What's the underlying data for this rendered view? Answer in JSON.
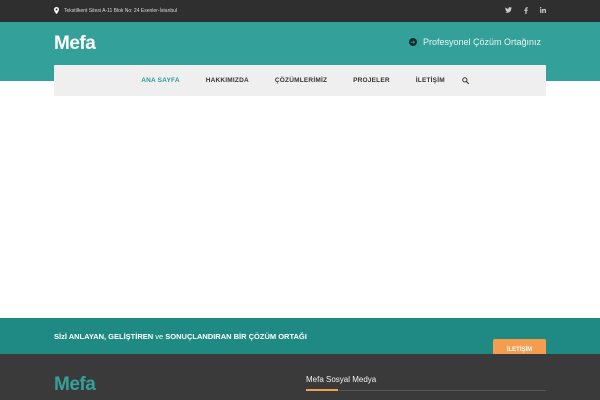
{
  "topbar": {
    "address": "Tekstilkent Sitesi A-11 Blok No: 24 Esenler-İstanbul",
    "icons": [
      "map-pin-icon",
      "twitter-icon",
      "facebook-icon",
      "linkedin-icon"
    ]
  },
  "header": {
    "logo": "Mefa",
    "tagline": "Profesyonel Çözüm Ortağınız"
  },
  "nav": {
    "items": [
      "ANA SAYFA",
      "HAKKIMIZDA",
      "ÇÖZÜMLERİMİZ",
      "PROJELER",
      "İLETİŞİM"
    ],
    "active": "ANA SAYFA"
  },
  "cta": {
    "text_bold_1": "Sİzİ ANLAYAN, GELİŞTİREN",
    "text_light": " ve ",
    "text_bold_2": "SONUÇLANDIRAN BİR ÇÖZÜM ORTAĞI",
    "button_label": "İLETİŞİM"
  },
  "footer": {
    "logo": "Mefa",
    "social_heading": "Mefa Sosyal Medya"
  },
  "colors": {
    "teal": "#34a09a",
    "dark_teal": "#1f8a83",
    "orange": "#f59c4f",
    "dark": "#2f2f2f"
  }
}
